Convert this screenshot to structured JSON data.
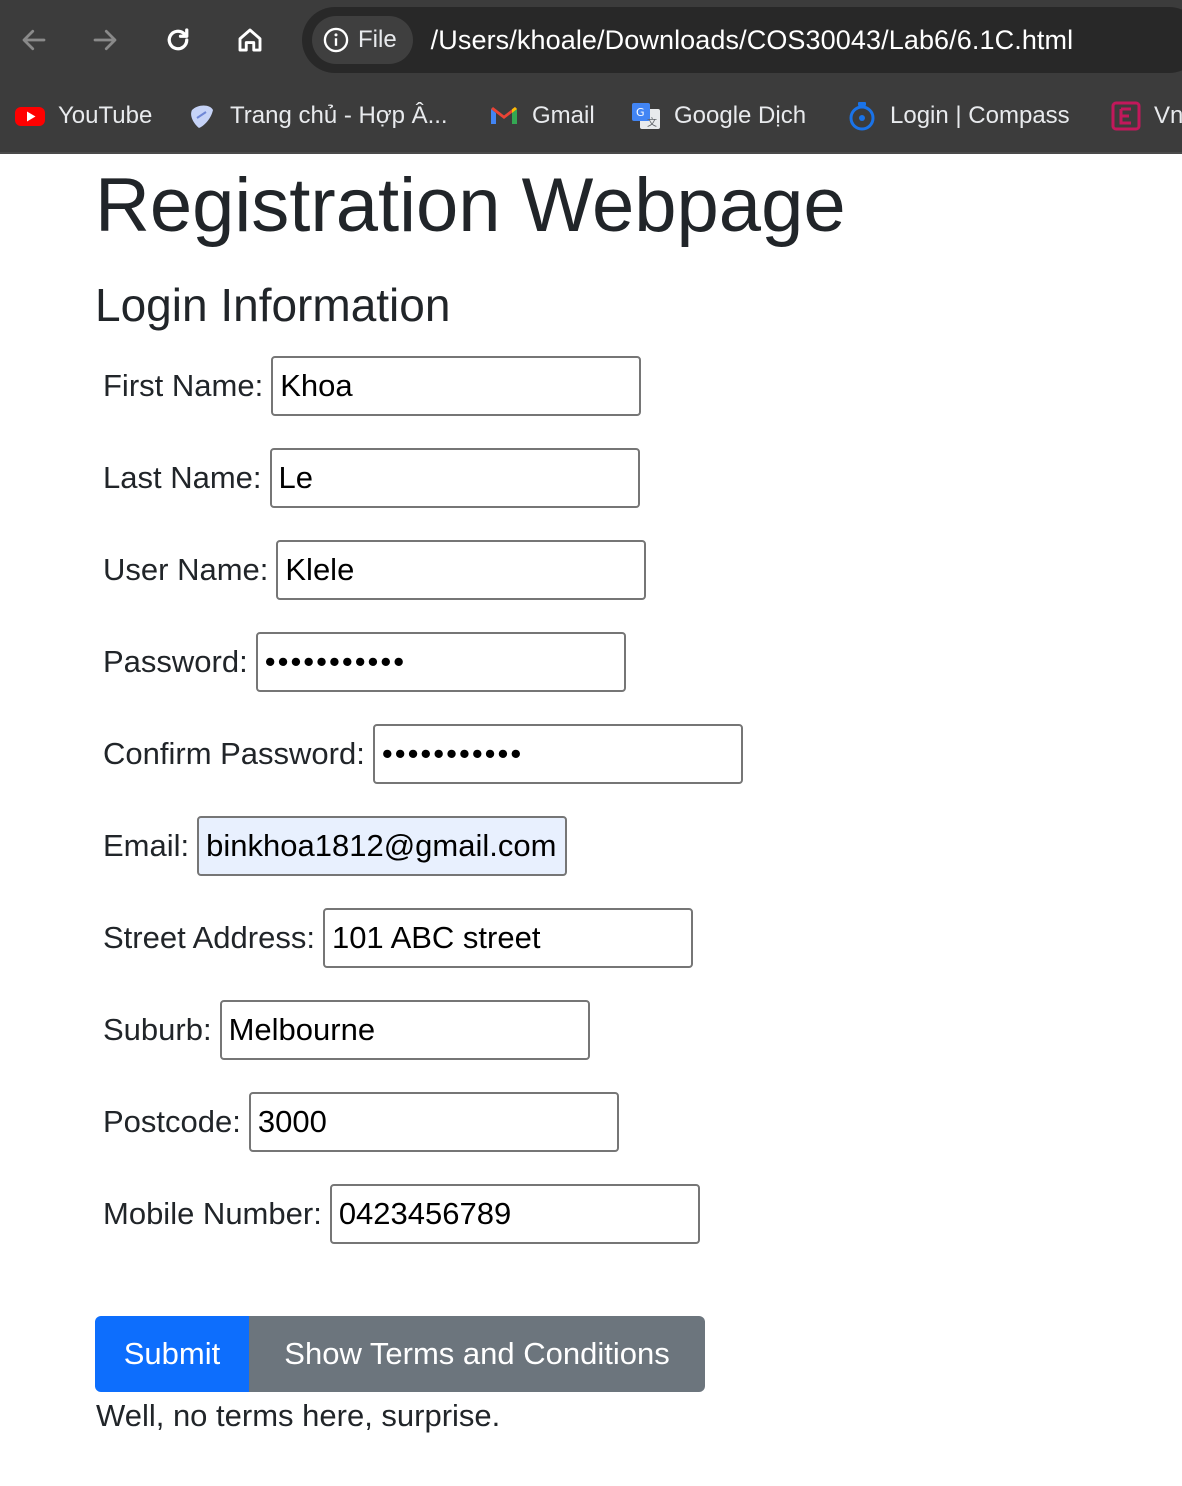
{
  "browser": {
    "site_chip_label": "File",
    "url": "/Users/khoale/Downloads/COS30043/Lab6/6.1C.html",
    "bookmarks": [
      {
        "label": "YouTube",
        "icon": "youtube-icon"
      },
      {
        "label": "Trang chủ - Hợp Â...",
        "icon": "guitar-pick-icon"
      },
      {
        "label": "Gmail",
        "icon": "gmail-icon"
      },
      {
        "label": "Google Dịch",
        "icon": "google-translate-icon"
      },
      {
        "label": "Login | Compass",
        "icon": "compass-icon"
      },
      {
        "label": "Vn",
        "icon": "e-logo-icon"
      }
    ]
  },
  "page": {
    "title": "Registration Webpage",
    "section_title": "Login Information",
    "fields": {
      "first_name": {
        "label": "First Name:",
        "value": "Khoa"
      },
      "last_name": {
        "label": "Last Name:",
        "value": "Le"
      },
      "user_name": {
        "label": "User Name:",
        "value": "Klele"
      },
      "password": {
        "label": "Password:",
        "value": "klele123456"
      },
      "confirm_password": {
        "label": "Confirm Password:",
        "value": "klele123456"
      },
      "email": {
        "label": "Email:",
        "value": "binkhoa1812@gmail.com"
      },
      "street_address": {
        "label": "Street Address:",
        "value": "101 ABC street"
      },
      "suburb": {
        "label": "Suburb:",
        "value": "Melbourne"
      },
      "postcode": {
        "label": "Postcode:",
        "value": "3000"
      },
      "mobile_number": {
        "label": "Mobile Number:",
        "value": "0423456789"
      }
    },
    "submit_label": "Submit",
    "terms_button_label": "Show Terms and Conditions",
    "terms_text": "Well, no terms here, surprise."
  },
  "colors": {
    "primary": "#0d6efd",
    "secondary": "#6c757d",
    "autofill": "#e8f0fe",
    "chrome": "#3c3c3c"
  }
}
